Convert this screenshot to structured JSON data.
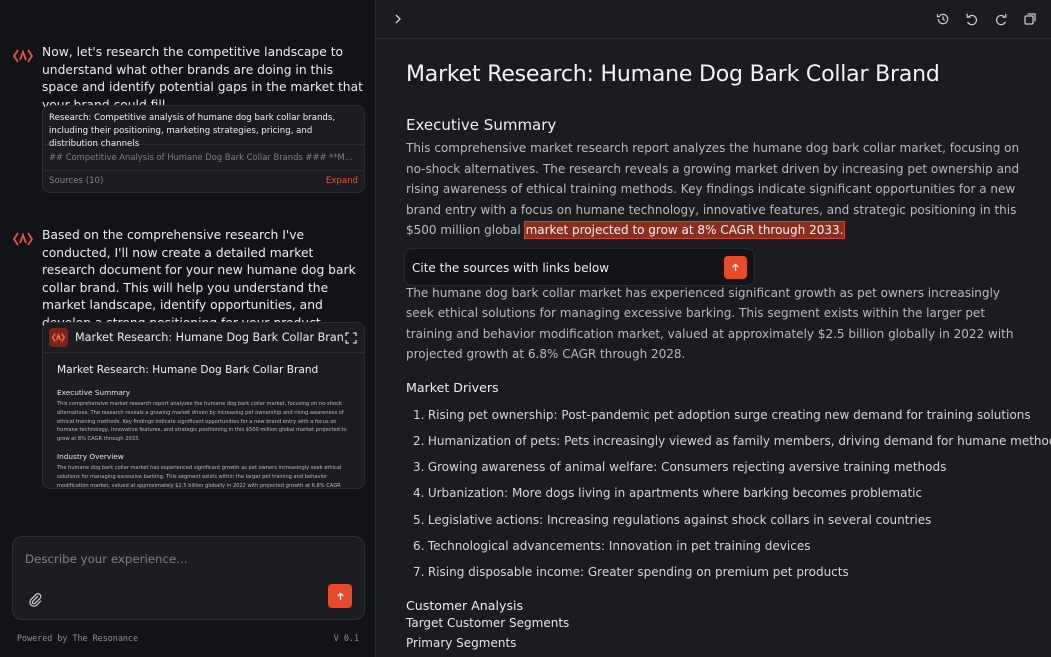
{
  "chat": {
    "message1": "Now, let's research the competitive landscape to understand what other brands are doing in this space and identify potential gaps in the market that your brand could fill.",
    "research": {
      "title": "Research: Competitive analysis of humane dog bark collar brands, including their positioning, marketing strategies, pricing, and distribution channels",
      "preview": "## Competitive Analysis of Humane Dog Bark Collar Brands ### **Market...",
      "sources_label": "Sources (10)",
      "expand_label": "Expand"
    },
    "message2": "Based on the comprehensive research I've conducted, I'll now create a detailed market research document for your new humane dog bark collar brand. This will help you understand the market landscape, identify opportunities, and develop a strong positioning for your product.",
    "doc_card": {
      "title": "Market Research: Humane Dog Bark Collar Brand",
      "body_title": "Market Research: Humane Dog Bark Collar Brand",
      "section1": "Executive Summary",
      "section1_text": "This comprehensive market research report analyzes the humane dog bark collar market, focusing on no-shock alternatives. The research reveals a growing market driven by increasing pet ownership and rising awareness of ethical training methods. Key findings indicate significant opportunities for a new brand entry with a focus on humane technology, innovative features, and strategic positioning in this $500 million global market projected to grow at 8% CAGR through 2033.",
      "section2": "Industry Overview",
      "section2_text": "The humane dog bark collar market has experienced significant growth as pet owners increasingly seek ethical solutions for managing excessive barking. This segment exists within the larger pet training and behavior modification market, valued at approximately $2.5 billion globally in 2022 with projected growth at 6.8% CAGR"
    },
    "composer": {
      "placeholder": "Describe your experience..."
    },
    "footer": {
      "left": "Powered by The Resonance",
      "right": "V 0.1"
    }
  },
  "document": {
    "title": "Market Research: Humane Dog Bark Collar Brand",
    "exec_heading": "Executive Summary",
    "exec_text": "This comprehensive market research report analyzes the humane dog bark collar market, focusing on no-shock alternatives. The research reveals a growing market driven by increasing pet ownership and rising awareness of ethical training methods. Key findings indicate significant opportunities for a new brand entry with a focus on humane technology, innovative features, and strategic positioning in this $500 million global",
    "exec_highlight": "market projected to grow at 8% CAGR through 2033.",
    "cite_prompt": "Cite the sources with links below",
    "industry_text": "The humane dog bark collar market has experienced significant growth as pet owners increasingly seek ethical solutions for managing excessive barking. This segment exists within the larger pet training and behavior modification market, valued at approximately $2.5 billion globally in 2022 with projected growth at 6.8% CAGR through 2028.",
    "drivers_heading": "Market Drivers",
    "drivers": [
      "Rising pet ownership: Post-pandemic pet adoption surge creating new demand for training solutions",
      "Humanization of pets: Pets increasingly viewed as family members, driving demand for humane methods",
      "Growing awareness of animal welfare: Consumers rejecting aversive training methods",
      "Urbanization: More dogs living in apartments where barking becomes problematic",
      "Legislative actions: Increasing regulations against shock collars in several countries",
      "Technological advancements: Innovation in pet training devices",
      "Rising disposable income: Greater spending on premium pet products"
    ],
    "customer_heading": "Customer Analysis",
    "customer_line1": "Target Customer Segments",
    "customer_line2": "Primary Segments"
  },
  "colors": {
    "accent": "#ea4a2c",
    "highlight": "#8a2f1f",
    "panel": "#121316",
    "document_bg": "#1b1c1f"
  },
  "icons": [
    "brand-logo-icon",
    "chevron-right-icon",
    "history-icon",
    "undo-icon",
    "redo-icon",
    "copy-icon",
    "fullscreen-icon",
    "paperclip-icon",
    "arrow-up-icon"
  ]
}
